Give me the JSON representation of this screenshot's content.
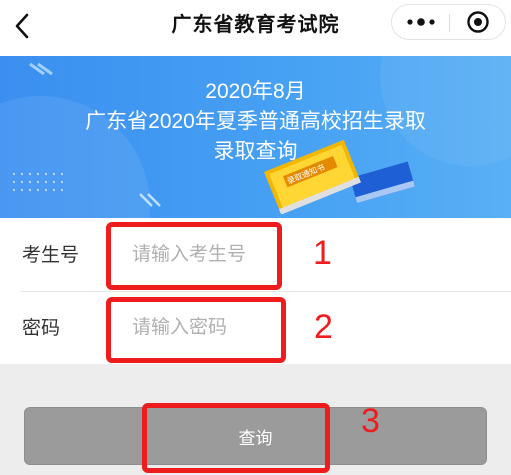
{
  "navbar": {
    "title": "广东省教育考试院",
    "back_icon": "chevron-left-icon",
    "more_icon": "more-dots-icon",
    "close_icon": "target-circle-icon"
  },
  "banner": {
    "line1": "2020年8月",
    "line2": "广东省2020年夏季普通高校招生录取",
    "line3": "录取查询",
    "book_label": "录取通知书",
    "colors": {
      "background": "#3b8ff0",
      "book": "#ffd633"
    }
  },
  "form": {
    "exam_number": {
      "label": "考生号",
      "placeholder": "请输入考生号",
      "value": ""
    },
    "password": {
      "label": "密码",
      "placeholder": "请输入密码",
      "value": ""
    }
  },
  "query_button": {
    "label": "查询"
  },
  "annotations": {
    "one": "1",
    "two": "2",
    "three": "3",
    "color": "#ee1c1c"
  }
}
